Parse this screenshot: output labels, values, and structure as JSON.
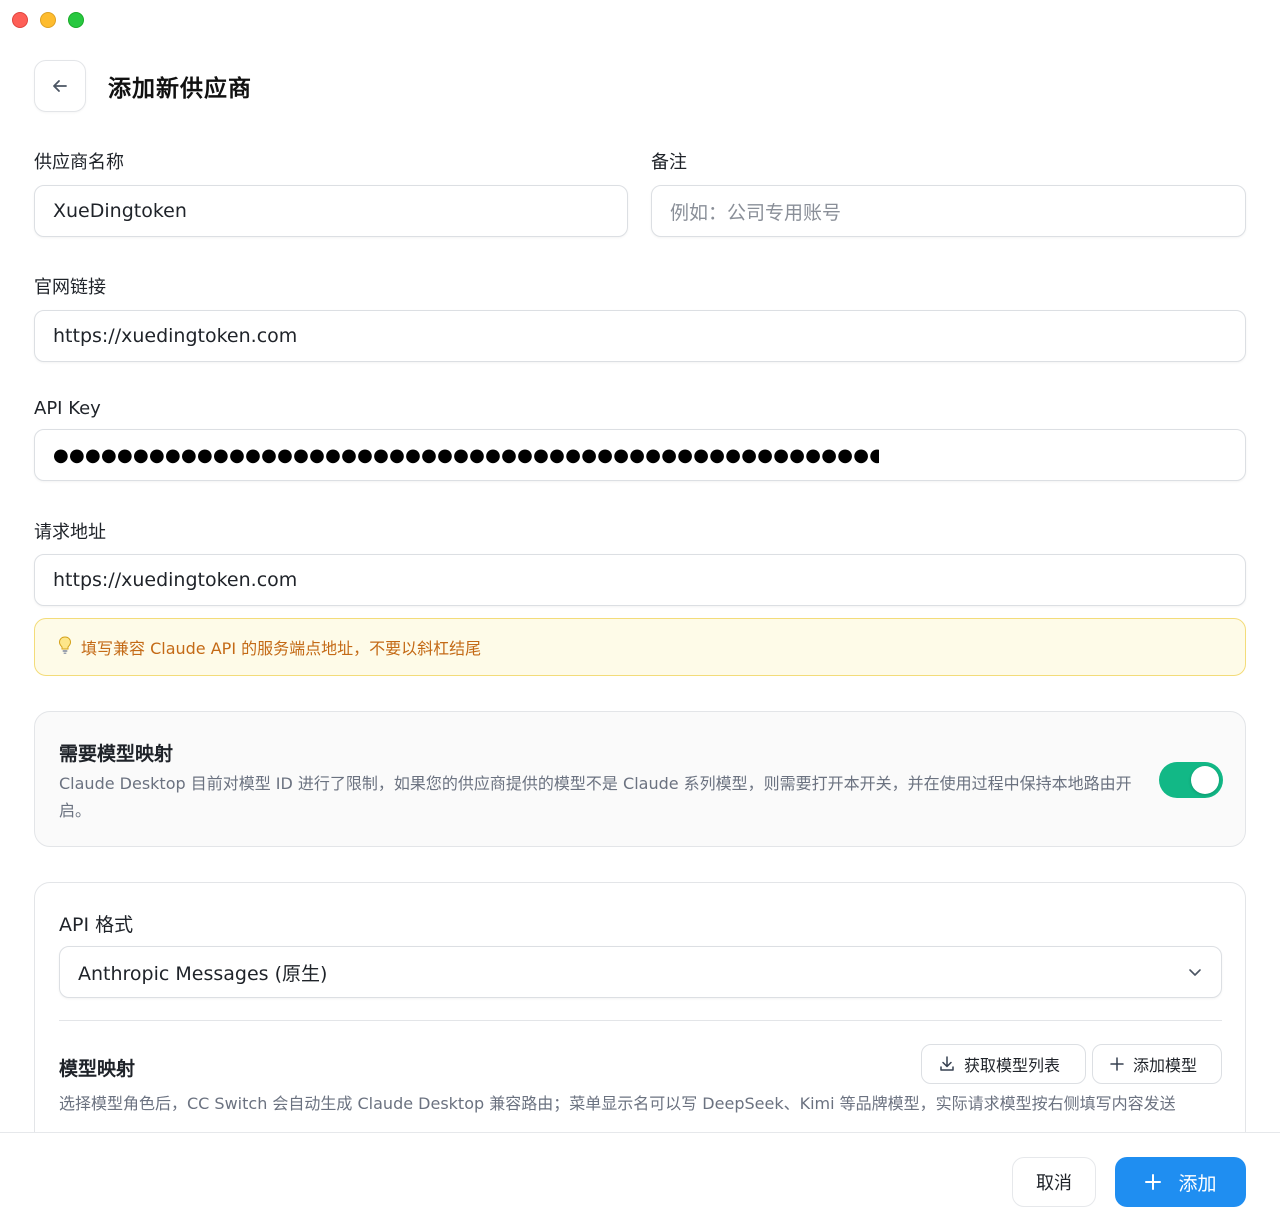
{
  "header": {
    "title": "添加新供应商"
  },
  "form": {
    "provider_name_label": "供应商名称",
    "provider_name_value": "XueDingtoken",
    "note_label": "备注",
    "note_placeholder": "例如：公司专用账号",
    "website_label": "官网链接",
    "website_value": "https://xuedingtoken.com",
    "api_key_label": "API Key",
    "api_key_value": "●●●●●●●●●●●●●●●●●●●●●●●●●●●●●●●●●●●●●●●●●●●●●●●●●●●●●●●●●●●●●●●●●●●●●●●●●●●●●●●●●●●●●●●●●",
    "endpoint_label": "请求地址",
    "endpoint_value": "https://xuedingtoken.com",
    "endpoint_hint": "填写兼容 Claude API 的服务端点地址，不要以斜杠结尾"
  },
  "mapping_card": {
    "title": "需要模型映射",
    "description": "Claude Desktop 目前对模型 ID 进行了限制，如果您的供应商提供的模型不是 Claude 系列模型，则需要打开本开关，并在使用过程中保持本地路由开启。",
    "toggle_on": true
  },
  "format_card": {
    "title": "API 格式",
    "format_value": "Anthropic Messages (原生)",
    "model_mapping_title": "模型映射",
    "fetch_models_label": "获取模型列表",
    "add_model_label": "添加模型",
    "model_mapping_desc": "选择模型角色后，CC Switch 会自动生成 Claude Desktop 兼容路由；菜单显示名可以写 DeepSeek、Kimi 等品牌模型，实际请求模型按右侧填写内容发送"
  },
  "footer": {
    "cancel_label": "取消",
    "add_label": "添加"
  },
  "colors": {
    "accent": "#1f8ef1",
    "toggle_on": "#12b886",
    "hint_text": "#c46a16",
    "hint_bg": "#fefbe8"
  }
}
